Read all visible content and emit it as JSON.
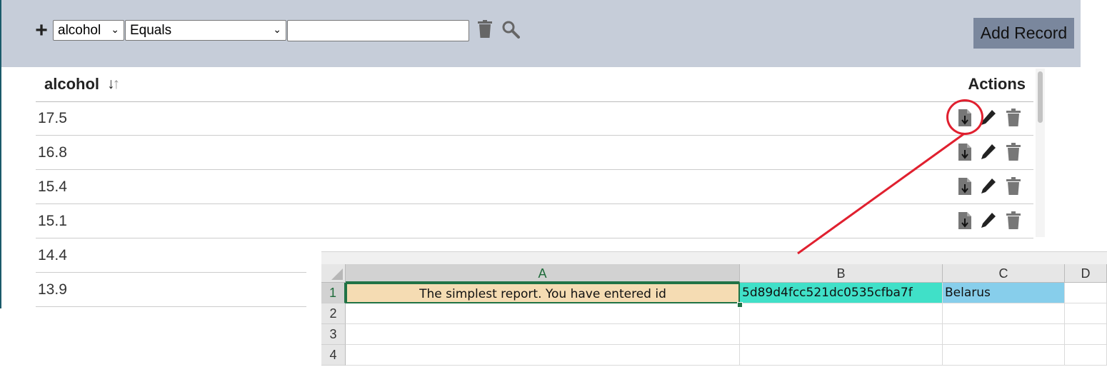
{
  "filter_bar": {
    "add_filter_icon": "plus-icon",
    "field_select": "alcohol",
    "operator_select": "Equals",
    "value_input": "",
    "clear_icon": "trash-icon",
    "search_icon": "search-icon",
    "add_record_label": "Add Record"
  },
  "table": {
    "header": {
      "column": "alcohol",
      "actions": "Actions"
    },
    "rows": [
      {
        "alcohol": "17.5",
        "has_actions": true
      },
      {
        "alcohol": "16.8",
        "has_actions": true
      },
      {
        "alcohol": "15.4",
        "has_actions": true
      },
      {
        "alcohol": "15.1",
        "has_actions": true
      },
      {
        "alcohol": "14.4",
        "has_actions": false
      },
      {
        "alcohol": "13.9",
        "has_actions": false
      }
    ],
    "action_icons": [
      "download-file-icon",
      "pencil-icon",
      "trash-icon"
    ]
  },
  "annotation": {
    "color": "#e0202f"
  },
  "spreadsheet": {
    "columns": [
      "A",
      "B",
      "C",
      "D"
    ],
    "row_numbers": [
      "1",
      "2",
      "3",
      "4"
    ],
    "cells": {
      "A1": "The simplest report. You have entered id",
      "B1": "5d89d4fcc521dc0535cfba7f",
      "C1": "Belarus"
    },
    "colors": {
      "A1": "#f5dcb3",
      "B1": "#40e0c8",
      "C1": "#87ceeb",
      "selection": "#217346"
    }
  }
}
